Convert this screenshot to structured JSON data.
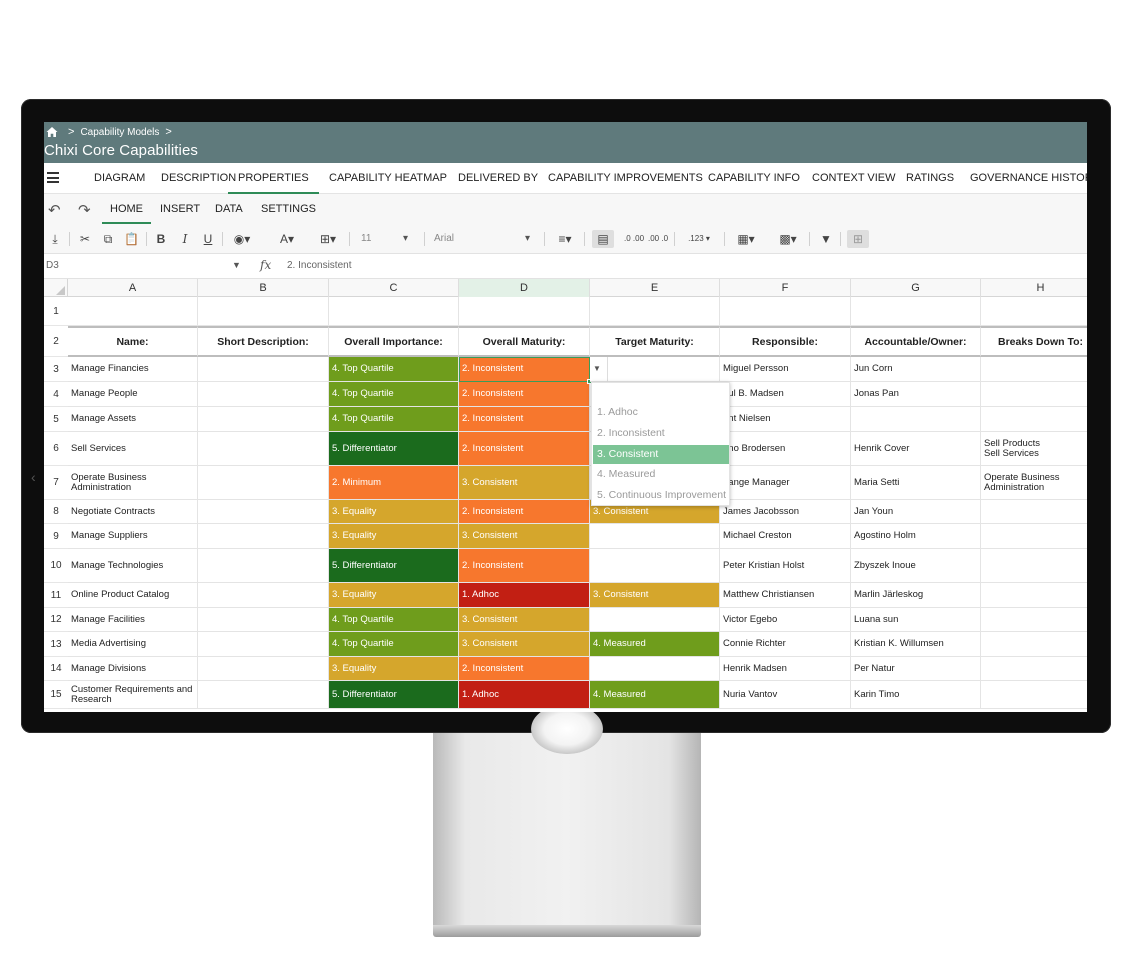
{
  "breadcrumb": {
    "root_icon": "home-icon",
    "item": "Capability Models",
    "sep": ">"
  },
  "app_title": "Chixi Core Capabilities",
  "nav_tabs": [
    "DIAGRAM",
    "DESCRIPTION",
    "PROPERTIES",
    "CAPABILITY HEATMAP",
    "DELIVERED BY",
    "CAPABILITY IMPROVEMENTS",
    "CAPABILITY INFO",
    "CONTEXT VIEW",
    "RATINGS",
    "GOVERNANCE HISTORY"
  ],
  "active_nav_tab": "PROPERTIES",
  "ribbon_tabs": [
    "HOME",
    "INSERT",
    "DATA",
    "SETTINGS"
  ],
  "active_ribbon_tab": "HOME",
  "toolbar": {
    "bold": "B",
    "italic": "I",
    "underline": "U",
    "font_color": "A",
    "font_size": "11",
    "font_family": "Arial",
    "dec_increase": ".0 .00",
    "dec_decrease": ".00 .0",
    "number_format": ".123"
  },
  "formula_bar": {
    "cell_ref": "D3",
    "fx": "fx",
    "value": "2. Inconsistent"
  },
  "columns": [
    "A",
    "B",
    "C",
    "D",
    "E",
    "F",
    "G",
    "H"
  ],
  "selected_column": "D",
  "headers": [
    "Name:",
    "Short Description:",
    "Overall Importance:",
    "Overall Maturity:",
    "Target Maturity:",
    "Responsible:",
    "Accountable/Owner:",
    "Breaks Down To:"
  ],
  "row_numbers": [
    "1",
    "2",
    "3",
    "4",
    "5",
    "6",
    "7",
    "8",
    "9",
    "10",
    "11",
    "12",
    "13",
    "14",
    "15"
  ],
  "rows": [
    {
      "name": "Manage Financies",
      "importance": "4. Top Quartile",
      "maturity": "2. Inconsistent",
      "target": "",
      "responsible": "Miguel Persson",
      "owner": "Jun Corn",
      "breaks": ""
    },
    {
      "name": "Manage People",
      "importance": "4. Top Quartile",
      "maturity": "2. Inconsistent",
      "target": "",
      "responsible": "aul B. Madsen",
      "owner": "Jonas Pan",
      "breaks": ""
    },
    {
      "name": "Manage Assets",
      "importance": "4. Top Quartile",
      "maturity": "2. Inconsistent",
      "target": "",
      "responsible": "ent Nielsen",
      "owner": "",
      "breaks": ""
    },
    {
      "name": "Sell Services",
      "importance": "5. Differentiator",
      "maturity": "2. Inconsistent",
      "target": "",
      "responsible": "uno Brodersen",
      "owner": "Henrik Cover",
      "breaks": "Sell Products\nSell Services"
    },
    {
      "name": "Operate Business Administration",
      "importance": "2. Minimum",
      "maturity": "3. Consistent",
      "target": "",
      "responsible": "hange Manager",
      "owner": "Maria Setti",
      "breaks": "Operate Business Administration"
    },
    {
      "name": "Negotiate Contracts",
      "importance": "3. Equality",
      "maturity": "2. Inconsistent",
      "target": "3. Consistent",
      "responsible": "James Jacobsson",
      "owner": "Jan Youn",
      "breaks": ""
    },
    {
      "name": "Manage Suppliers",
      "importance": "3. Equality",
      "maturity": "3. Consistent",
      "target": "",
      "responsible": "Michael Creston",
      "owner": "Agostino Holm",
      "breaks": ""
    },
    {
      "name": "Manage Technologies",
      "importance": "5. Differentiator",
      "maturity": "2. Inconsistent",
      "target": "",
      "responsible": "Peter Kristian Holst",
      "owner": "Zbyszek Inoue",
      "breaks": ""
    },
    {
      "name": "Online Product Catalog",
      "importance": "3. Equality",
      "maturity": "1. Adhoc",
      "target": "3. Consistent",
      "responsible": "Matthew Christiansen",
      "owner": "Marlin Järleskog",
      "breaks": ""
    },
    {
      "name": "Manage Facilities",
      "importance": "4. Top Quartile",
      "maturity": "3. Consistent",
      "target": "",
      "responsible": "Victor Egebo",
      "owner": "Luana sun",
      "breaks": ""
    },
    {
      "name": "Media Advertising",
      "importance": "4. Top Quartile",
      "maturity": "3. Consistent",
      "target": "4. Measured",
      "responsible": "Connie Richter",
      "owner": "Kristian K. Willumsen",
      "breaks": ""
    },
    {
      "name": "Manage Divisions",
      "importance": "3. Equality",
      "maturity": "2. Inconsistent",
      "target": "",
      "responsible": "Henrik Madsen",
      "owner": "Per Natur",
      "breaks": ""
    },
    {
      "name": "Customer Requirements and Research",
      "importance": "5. Differentiator",
      "maturity": "1. Adhoc",
      "target": "4. Measured",
      "responsible": "Nuria Vantov",
      "owner": "Karin Timo",
      "breaks": ""
    }
  ],
  "dropdown_options": [
    "1. Adhoc",
    "2. Inconsistent",
    "3. Consistent",
    "4. Measured",
    "5. Continuous Improvement"
  ],
  "dropdown_selected": "3. Consistent",
  "value_colors": {
    "5. Differentiator": "#1b6b1d",
    "4. Top Quartile": "#6f9d1c",
    "3. Equality": "#d5a62c",
    "2. Minimum": "#f7772d",
    "2. Inconsistent": "#f7772d",
    "3. Consistent": "#d5a62c",
    "4. Measured": "#6f9d1c",
    "1. Adhoc": "#c21f13"
  }
}
